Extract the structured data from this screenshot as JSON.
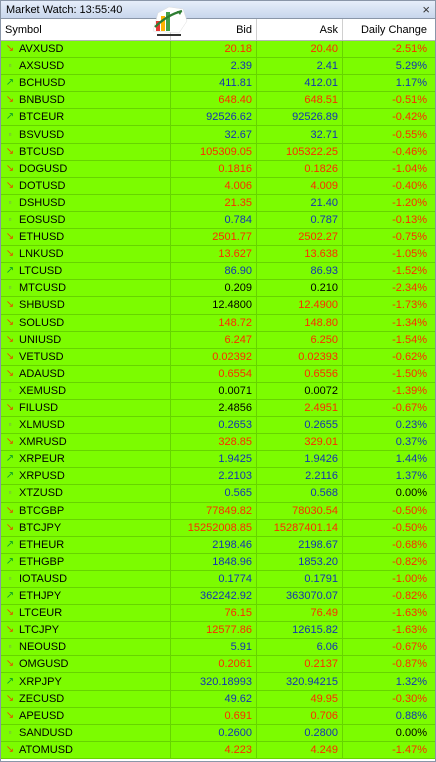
{
  "window": {
    "title": "Market Watch: 13:55:40",
    "close_icon": "close-icon"
  },
  "columns": {
    "symbol": "Symbol",
    "bid": "Bid",
    "ask": "Ask",
    "change": "Daily Change"
  },
  "colors": {
    "row_background": "#7cfc00",
    "down_value": "#ff2a00",
    "up_value": "#1433b4",
    "down_arrow": "#e64a00",
    "up_arrow": "#0a9a2a"
  },
  "rows": [
    {
      "symbol": "AVXUSD",
      "dir": "down",
      "bid": "20.18",
      "ask": "20.40",
      "change": "-2.51%",
      "bid_tone": "red",
      "ask_tone": "red",
      "chg_tone": "red"
    },
    {
      "symbol": "AXSUSD",
      "dir": "flat",
      "bid": "2.39",
      "ask": "2.41",
      "change": "5.29%",
      "bid_tone": "blue",
      "ask_tone": "blue",
      "chg_tone": "blue"
    },
    {
      "symbol": "BCHUSD",
      "dir": "up",
      "bid": "411.81",
      "ask": "412.01",
      "change": "1.17%",
      "bid_tone": "blue",
      "ask_tone": "blue",
      "chg_tone": "blue"
    },
    {
      "symbol": "BNBUSD",
      "dir": "down",
      "bid": "648.40",
      "ask": "648.51",
      "change": "-0.51%",
      "bid_tone": "red",
      "ask_tone": "red",
      "chg_tone": "red"
    },
    {
      "symbol": "BTCEUR",
      "dir": "up",
      "bid": "92526.62",
      "ask": "92526.89",
      "change": "-0.42%",
      "bid_tone": "blue",
      "ask_tone": "blue",
      "chg_tone": "red"
    },
    {
      "symbol": "BSVUSD",
      "dir": "flat",
      "bid": "32.67",
      "ask": "32.71",
      "change": "-0.55%",
      "bid_tone": "blue",
      "ask_tone": "blue",
      "chg_tone": "red"
    },
    {
      "symbol": "BTCUSD",
      "dir": "down",
      "bid": "105309.05",
      "ask": "105322.25",
      "change": "-0.46%",
      "bid_tone": "red",
      "ask_tone": "red",
      "chg_tone": "red"
    },
    {
      "symbol": "DOGUSD",
      "dir": "down",
      "bid": "0.1816",
      "ask": "0.1826",
      "change": "-1.04%",
      "bid_tone": "red",
      "ask_tone": "red",
      "chg_tone": "red"
    },
    {
      "symbol": "DOTUSD",
      "dir": "down",
      "bid": "4.006",
      "ask": "4.009",
      "change": "-0.40%",
      "bid_tone": "red",
      "ask_tone": "red",
      "chg_tone": "red"
    },
    {
      "symbol": "DSHUSD",
      "dir": "flat",
      "bid": "21.35",
      "ask": "21.40",
      "change": "-1.20%",
      "bid_tone": "red",
      "ask_tone": "blue",
      "chg_tone": "red"
    },
    {
      "symbol": "EOSUSD",
      "dir": "flat",
      "bid": "0.784",
      "ask": "0.787",
      "change": "-0.13%",
      "bid_tone": "blue",
      "ask_tone": "blue",
      "chg_tone": "red"
    },
    {
      "symbol": "ETHUSD",
      "dir": "down",
      "bid": "2501.77",
      "ask": "2502.27",
      "change": "-0.75%",
      "bid_tone": "red",
      "ask_tone": "red",
      "chg_tone": "red"
    },
    {
      "symbol": "LNKUSD",
      "dir": "down",
      "bid": "13.627",
      "ask": "13.638",
      "change": "-1.05%",
      "bid_tone": "red",
      "ask_tone": "red",
      "chg_tone": "red"
    },
    {
      "symbol": "LTCUSD",
      "dir": "up",
      "bid": "86.90",
      "ask": "86.93",
      "change": "-1.52%",
      "bid_tone": "blue",
      "ask_tone": "blue",
      "chg_tone": "red"
    },
    {
      "symbol": "MTCUSD",
      "dir": "flat",
      "bid": "0.209",
      "ask": "0.210",
      "change": "-2.34%",
      "bid_tone": "black",
      "ask_tone": "black",
      "chg_tone": "red"
    },
    {
      "symbol": "SHBUSD",
      "dir": "down",
      "bid": "12.4800",
      "ask": "12.4900",
      "change": "-1.73%",
      "bid_tone": "black",
      "ask_tone": "red",
      "chg_tone": "red"
    },
    {
      "symbol": "SOLUSD",
      "dir": "down",
      "bid": "148.72",
      "ask": "148.80",
      "change": "-1.34%",
      "bid_tone": "red",
      "ask_tone": "red",
      "chg_tone": "red"
    },
    {
      "symbol": "UNIUSD",
      "dir": "down",
      "bid": "6.247",
      "ask": "6.250",
      "change": "-1.54%",
      "bid_tone": "red",
      "ask_tone": "red",
      "chg_tone": "red"
    },
    {
      "symbol": "VETUSD",
      "dir": "down",
      "bid": "0.02392",
      "ask": "0.02393",
      "change": "-0.62%",
      "bid_tone": "red",
      "ask_tone": "red",
      "chg_tone": "red"
    },
    {
      "symbol": "ADAUSD",
      "dir": "down",
      "bid": "0.6554",
      "ask": "0.6556",
      "change": "-1.50%",
      "bid_tone": "red",
      "ask_tone": "red",
      "chg_tone": "red"
    },
    {
      "symbol": "XEMUSD",
      "dir": "flat",
      "bid": "0.0071",
      "ask": "0.0072",
      "change": "-1.39%",
      "bid_tone": "black",
      "ask_tone": "black",
      "chg_tone": "red"
    },
    {
      "symbol": "FILUSD",
      "dir": "down",
      "bid": "2.4856",
      "ask": "2.4951",
      "change": "-0.67%",
      "bid_tone": "black",
      "ask_tone": "red",
      "chg_tone": "red"
    },
    {
      "symbol": "XLMUSD",
      "dir": "flat",
      "bid": "0.2653",
      "ask": "0.2655",
      "change": "0.23%",
      "bid_tone": "blue",
      "ask_tone": "blue",
      "chg_tone": "blue"
    },
    {
      "symbol": "XMRUSD",
      "dir": "down",
      "bid": "328.85",
      "ask": "329.01",
      "change": "0.37%",
      "bid_tone": "red",
      "ask_tone": "red",
      "chg_tone": "blue"
    },
    {
      "symbol": "XRPEUR",
      "dir": "up",
      "bid": "1.9425",
      "ask": "1.9426",
      "change": "1.44%",
      "bid_tone": "blue",
      "ask_tone": "blue",
      "chg_tone": "blue"
    },
    {
      "symbol": "XRPUSD",
      "dir": "up",
      "bid": "2.2103",
      "ask": "2.2116",
      "change": "1.37%",
      "bid_tone": "blue",
      "ask_tone": "blue",
      "chg_tone": "blue"
    },
    {
      "symbol": "XTZUSD",
      "dir": "flat",
      "bid": "0.565",
      "ask": "0.568",
      "change": "0.00%",
      "bid_tone": "blue",
      "ask_tone": "blue",
      "chg_tone": "black"
    },
    {
      "symbol": "BTCGBP",
      "dir": "down",
      "bid": "77849.82",
      "ask": "78030.54",
      "change": "-0.50%",
      "bid_tone": "red",
      "ask_tone": "red",
      "chg_tone": "red"
    },
    {
      "symbol": "BTCJPY",
      "dir": "down",
      "bid": "15252008.85",
      "ask": "15287401.14",
      "change": "-0.50%",
      "bid_tone": "red",
      "ask_tone": "red",
      "chg_tone": "red"
    },
    {
      "symbol": "ETHEUR",
      "dir": "up",
      "bid": "2198.46",
      "ask": "2198.67",
      "change": "-0.68%",
      "bid_tone": "blue",
      "ask_tone": "blue",
      "chg_tone": "red"
    },
    {
      "symbol": "ETHGBP",
      "dir": "up",
      "bid": "1848.96",
      "ask": "1853.20",
      "change": "-0.82%",
      "bid_tone": "blue",
      "ask_tone": "blue",
      "chg_tone": "red"
    },
    {
      "symbol": "IOTAUSD",
      "dir": "flat",
      "bid": "0.1774",
      "ask": "0.1791",
      "change": "-1.00%",
      "bid_tone": "blue",
      "ask_tone": "blue",
      "chg_tone": "red"
    },
    {
      "symbol": "ETHJPY",
      "dir": "up",
      "bid": "362242.92",
      "ask": "363070.07",
      "change": "-0.82%",
      "bid_tone": "blue",
      "ask_tone": "blue",
      "chg_tone": "red"
    },
    {
      "symbol": "LTCEUR",
      "dir": "down",
      "bid": "76.15",
      "ask": "76.49",
      "change": "-1.63%",
      "bid_tone": "red",
      "ask_tone": "red",
      "chg_tone": "red"
    },
    {
      "symbol": "LTCJPY",
      "dir": "down",
      "bid": "12577.86",
      "ask": "12615.82",
      "change": "-1.63%",
      "bid_tone": "red",
      "ask_tone": "blue",
      "chg_tone": "red"
    },
    {
      "symbol": "NEOUSD",
      "dir": "flat",
      "bid": "5.91",
      "ask": "6.06",
      "change": "-0.67%",
      "bid_tone": "blue",
      "ask_tone": "blue",
      "chg_tone": "red"
    },
    {
      "symbol": "OMGUSD",
      "dir": "down",
      "bid": "0.2061",
      "ask": "0.2137",
      "change": "-0.87%",
      "bid_tone": "red",
      "ask_tone": "red",
      "chg_tone": "red"
    },
    {
      "symbol": "XRPJPY",
      "dir": "up",
      "bid": "320.18993",
      "ask": "320.94215",
      "change": "1.32%",
      "bid_tone": "blue",
      "ask_tone": "blue",
      "chg_tone": "blue"
    },
    {
      "symbol": "ZECUSD",
      "dir": "down",
      "bid": "49.62",
      "ask": "49.95",
      "change": "-0.30%",
      "bid_tone": "blue",
      "ask_tone": "red",
      "chg_tone": "red"
    },
    {
      "symbol": "APEUSD",
      "dir": "down",
      "bid": "0.691",
      "ask": "0.706",
      "change": "0.88%",
      "bid_tone": "red",
      "ask_tone": "red",
      "chg_tone": "blue"
    },
    {
      "symbol": "SANDUSD",
      "dir": "flat",
      "bid": "0.2600",
      "ask": "0.2800",
      "change": "0.00%",
      "bid_tone": "blue",
      "ask_tone": "blue",
      "chg_tone": "black"
    },
    {
      "symbol": "ATOMUSD",
      "dir": "down",
      "bid": "4.223",
      "ask": "4.249",
      "change": "-1.47%",
      "bid_tone": "red",
      "ask_tone": "red",
      "chg_tone": "red"
    }
  ]
}
